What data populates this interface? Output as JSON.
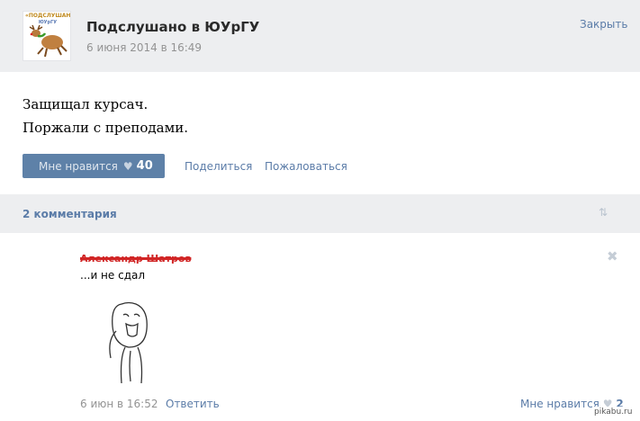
{
  "header": {
    "avatar_text_top": "«ПОДСЛУШАНО»",
    "avatar_text_bottom": "ЮУрГУ",
    "group_name": "Подслушано в ЮУрГУ",
    "date": "6 июня 2014 в 16:49",
    "close_label": "Закрыть"
  },
  "post": {
    "lines": [
      "Защищал курсач.",
      "Поржали с преподами."
    ]
  },
  "actions": {
    "like_label": "Мне нравится",
    "like_icon": "heart-icon",
    "like_count": "40",
    "share_label": "Поделиться",
    "report_label": "Пожаловаться"
  },
  "comments": {
    "count_label": "2 комментария",
    "sort_icon": "sort-arrows-icon",
    "items": [
      {
        "author": "Александр Шатров",
        "text": "...и не сдал",
        "date": "6 июн в 16:52",
        "reply_label": "Ответить",
        "like_label": "Мне нравится",
        "like_count": "2",
        "close_icon": "close-icon"
      }
    ]
  },
  "watermark": "pikabu.ru",
  "colors": {
    "link": "#5b7ca8",
    "like_button": "#5e81a8",
    "header_bg": "#edeef0",
    "muted": "#939393"
  }
}
